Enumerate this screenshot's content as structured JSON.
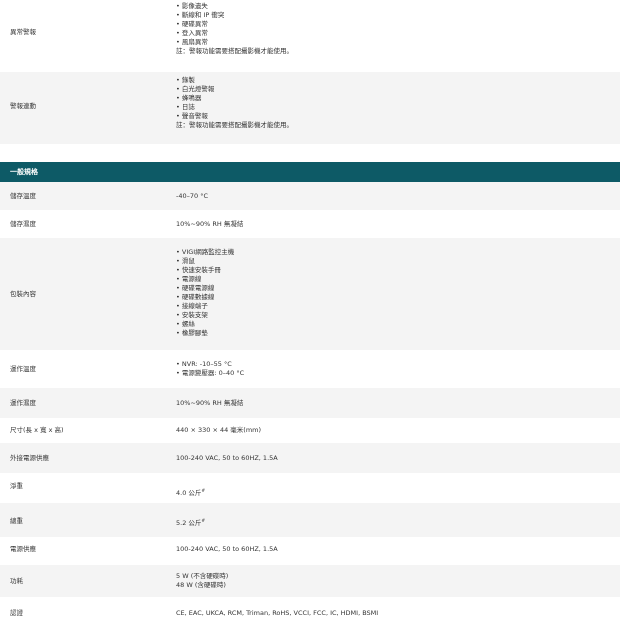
{
  "abnormal_alarm": {
    "label": "異常警報",
    "items": [
      "影像遺失",
      "斷線和 IP 衝突",
      "硬碟異常",
      "登入異常",
      "風扇異常"
    ],
    "note": "註：警報功能需要搭配攝影機才能使用。"
  },
  "alarm_linkage": {
    "label": "警報連動",
    "items": [
      "錄製",
      "白光燈警報",
      "蜂鳴器",
      "日誌",
      "聲音警報"
    ],
    "note": "註：警報功能需要搭配攝影機才能使用。"
  },
  "general_specs": {
    "header": "一般規格",
    "storage_temp": {
      "label": "儲存溫度",
      "value": "-40–70 °C"
    },
    "storage_humidity": {
      "label": "儲存濕度",
      "value": "10%~90% RH 無凝結"
    },
    "package": {
      "label": "包裝內容",
      "items": [
        "VIGI網路監控主機",
        "滑鼠",
        "快速安裝手冊",
        "電源線",
        "硬碟電源線",
        "硬碟數據線",
        "接線端子",
        "安裝支架",
        "螺絲",
        "橡膠腳墊"
      ]
    },
    "operating_temp": {
      "label": "運作溫度",
      "items": [
        "NVR: -10–55 °C",
        "電源變壓器: 0–40 °C"
      ]
    },
    "operating_humidity": {
      "label": "運作濕度",
      "value": "10%~90% RH 無凝結"
    },
    "dimensions": {
      "label": "尺寸(長 x 寬 x 高)",
      "value": "440 × 330 × 44 毫米(mm)"
    },
    "external_power": {
      "label": "外接電源供應",
      "value": "100-240 VAC, 50 to 60HZ, 1.5A"
    },
    "net_weight": {
      "label": "淨重",
      "value": "4.0 公斤",
      "sup": "#"
    },
    "gross_weight": {
      "label": "總重",
      "value": "5.2 公斤",
      "sup": "#"
    },
    "power_supply": {
      "label": "電源供應",
      "value": "100-240 VAC, 50 to 60HZ, 1.5A"
    },
    "power_consumption": {
      "label": "功耗",
      "lines": [
        "5 W (不含硬碟時)",
        "48 W (含硬碟時)"
      ]
    },
    "certification": {
      "label": "認證",
      "value": "CE, EAC, UKCA, RCM, Triman, RoHS, VCCI, FCC, IC, HDMI, BSMI"
    }
  }
}
